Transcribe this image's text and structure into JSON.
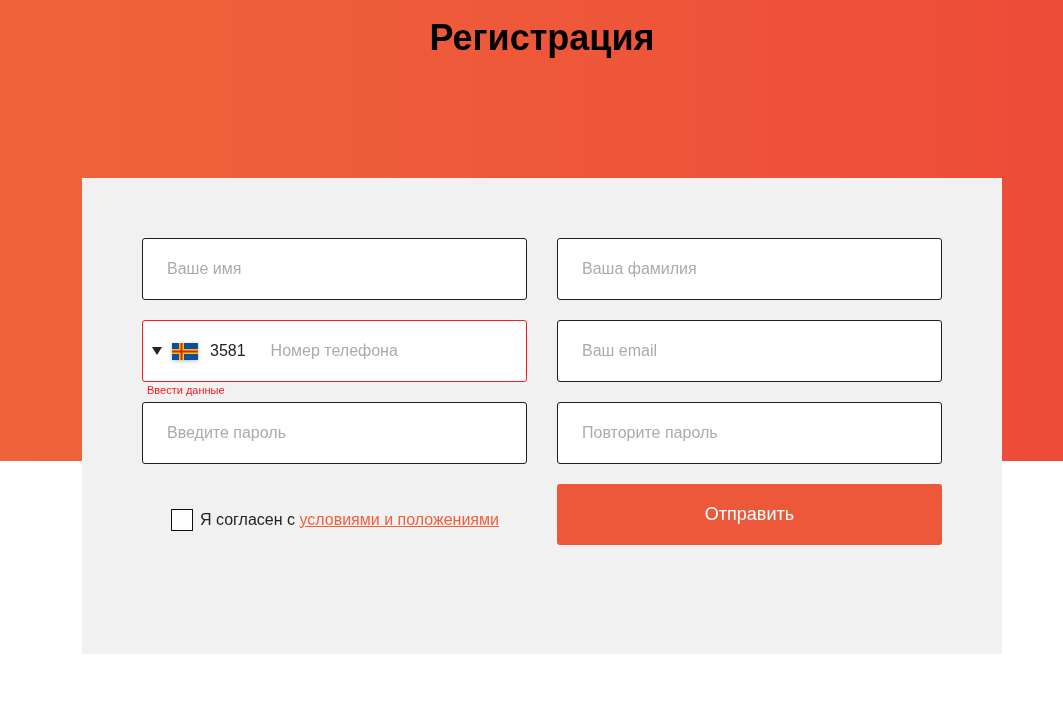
{
  "title": "Регистрация",
  "form": {
    "fields": [
      {
        "kind": "text",
        "placeholder": "Ваше имя",
        "invalid": false
      },
      {
        "kind": "text",
        "placeholder": "Ваша фамилия",
        "invalid": false
      },
      {
        "kind": "phone",
        "country_code": "3581",
        "placeholder": "Номер телефона",
        "invalid": true,
        "error": "Ввести данные"
      },
      {
        "kind": "email",
        "placeholder": "Ваш email",
        "invalid": false
      },
      {
        "kind": "password",
        "placeholder": "Введите пароль",
        "invalid": false
      },
      {
        "kind": "password",
        "placeholder": "Повторите пароль",
        "invalid": false
      }
    ],
    "consent": {
      "checked": false,
      "text": "Я согласен с",
      "link": "условиями и положениями"
    },
    "submit": "Отправить"
  }
}
